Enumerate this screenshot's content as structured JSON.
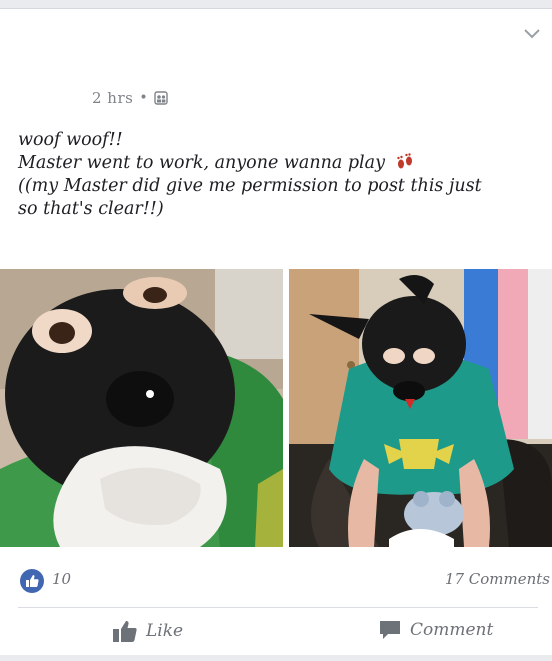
{
  "post": {
    "time": "2 hrs",
    "separator": "•",
    "privacy_icon": "friends-icon",
    "text_lines": [
      "woof woof!!",
      "Master went to work, anyone wanna play",
      "((my Master did give me permission to post this just",
      "so that's clear!!)"
    ],
    "emoji_icon": "paw-prints-icon"
  },
  "photos": [
    {
      "name": "photo-1"
    },
    {
      "name": "photo-2"
    }
  ],
  "stats": {
    "like_count": "10",
    "comment_count": "17 Comments"
  },
  "actions": {
    "like_label": "Like",
    "comment_label": "Comment"
  },
  "colors": {
    "like_blue": "#4267b2",
    "text": "#1d1f24",
    "muted": "#6d7178",
    "mask_black": "#1a1a1a",
    "shirt_green": "#2f8a5a",
    "teal_shirt": "#1e9a8a"
  }
}
